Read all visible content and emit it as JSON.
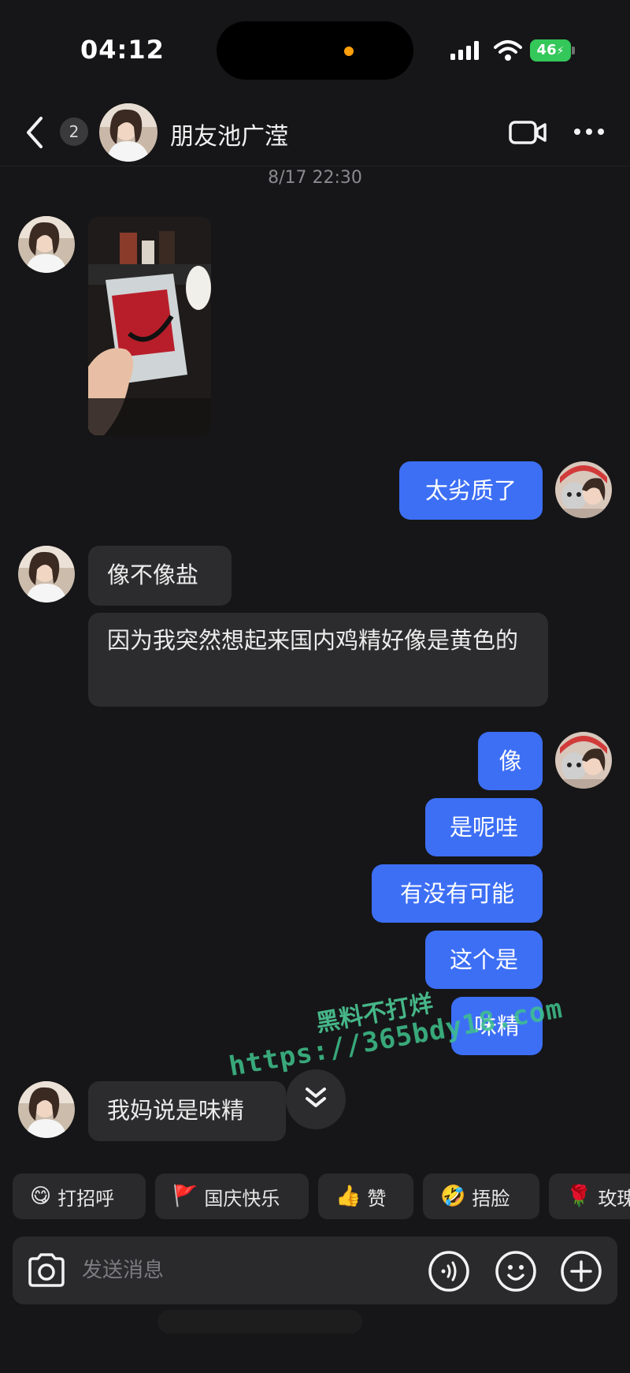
{
  "status_bar": {
    "time": "04:12",
    "battery": "46"
  },
  "header": {
    "unread_count": "2",
    "contact_name": "朋友池广滢",
    "icons": {
      "back": "chevron-left-icon",
      "video": "video-camera-icon",
      "more": "more-dots-icon"
    }
  },
  "chat": {
    "timestamp": "8/17 22:30",
    "messages": [
      {
        "from": "them",
        "kind": "image"
      },
      {
        "from": "me",
        "text": "太劣质了"
      },
      {
        "from": "them",
        "text": "像不像盐"
      },
      {
        "from": "them",
        "text": "因为我突然想起来国内鸡精好像是黄色的"
      },
      {
        "from": "me",
        "text": "像"
      },
      {
        "from": "me",
        "text": "是呢哇"
      },
      {
        "from": "me",
        "text": "有没有可能"
      },
      {
        "from": "me",
        "text": "这个是"
      },
      {
        "from": "me",
        "text": "味精"
      },
      {
        "from": "them",
        "text": "我妈说是味精"
      }
    ]
  },
  "watermark": {
    "line1": "黑料不打烊",
    "line2": "https://365bdy18.com"
  },
  "quick_replies": [
    {
      "emoji": "😋",
      "label": "打招呼"
    },
    {
      "emoji": "🚩",
      "label": "国庆快乐"
    },
    {
      "emoji": "👍",
      "label": "赞"
    },
    {
      "emoji": "🤣",
      "label": "捂脸"
    },
    {
      "emoji": "🌹",
      "label": "玫瑰"
    }
  ],
  "composer": {
    "placeholder": "发送消息"
  }
}
